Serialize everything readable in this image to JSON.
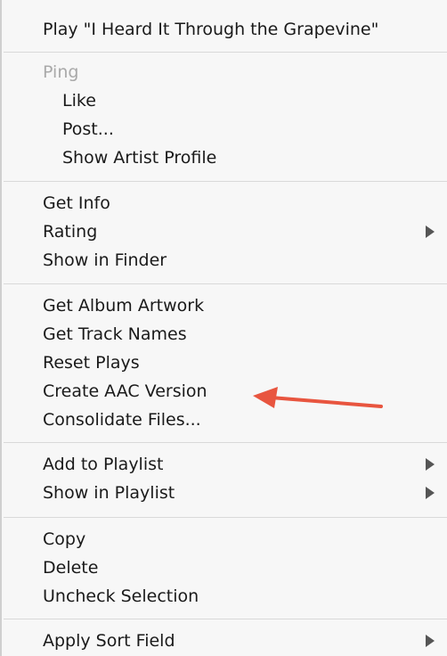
{
  "menu": {
    "items": [
      {
        "label": "Play \"I Heard It Through the Grapevine\""
      },
      {
        "label": "Ping"
      },
      {
        "label": "Like"
      },
      {
        "label": "Post..."
      },
      {
        "label": "Show Artist Profile"
      },
      {
        "label": "Get Info"
      },
      {
        "label": "Rating"
      },
      {
        "label": "Show in Finder"
      },
      {
        "label": "Get Album Artwork"
      },
      {
        "label": "Get Track Names"
      },
      {
        "label": "Reset Plays"
      },
      {
        "label": "Create AAC Version"
      },
      {
        "label": "Consolidate Files..."
      },
      {
        "label": "Add to Playlist"
      },
      {
        "label": "Show in Playlist"
      },
      {
        "label": "Copy"
      },
      {
        "label": "Delete"
      },
      {
        "label": "Uncheck Selection"
      },
      {
        "label": "Apply Sort Field"
      }
    ]
  },
  "colors": {
    "annotation_arrow": "#e8553f",
    "disabled_text": "#a9a9a9"
  }
}
